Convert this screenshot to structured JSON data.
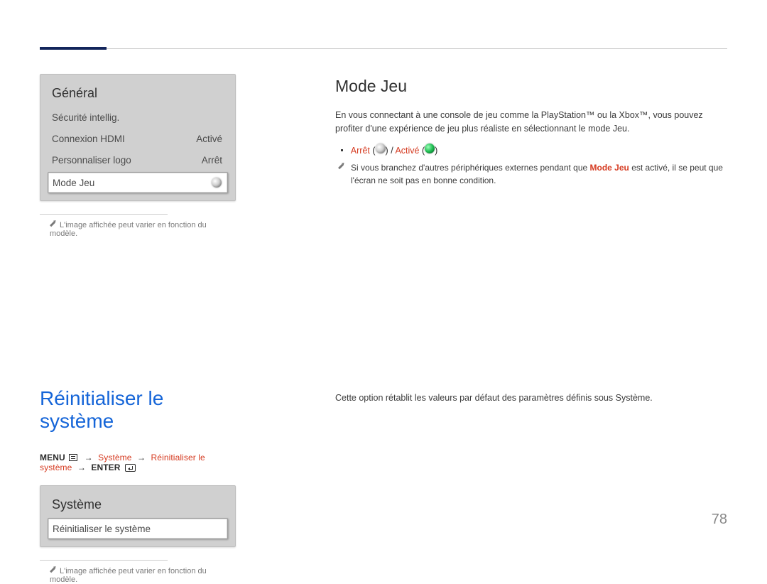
{
  "pageNumber": "78",
  "panel1": {
    "title": "Général",
    "rows": [
      {
        "label": "Sécurité intellig.",
        "value": ""
      },
      {
        "label": "Connexion HDMI",
        "value": "Activé"
      },
      {
        "label": "Personnaliser logo",
        "value": "Arrêt"
      }
    ],
    "selected": {
      "label": "Mode Jeu"
    }
  },
  "note_img_varies": "L'image affichée peut varier en fonction du modèle.",
  "modeJeu": {
    "heading": "Mode Jeu",
    "desc": "En vous connectant à une console de jeu comme la PlayStation™ ou la Xbox™, vous pouvez profiter d'une expérience de jeu plus réaliste en sélectionnant le mode Jeu.",
    "opt_off": "Arrêt",
    "opt_on": "Activé",
    "warn_prefix": "Si vous branchez d'autres périphériques externes pendant que ",
    "warn_term": "Mode Jeu",
    "warn_suffix": " est activé, il se peut que l'écran ne soit pas en bonne condition."
  },
  "reset": {
    "title": "Réinitialiser le système",
    "path_menu": "MENU",
    "path_systeme": "Système",
    "path_reinit": "Réinitialiser le système",
    "path_enter": "ENTER",
    "desc": "Cette option rétablit les valeurs par défaut des paramètres définis sous Système."
  },
  "panel2": {
    "title": "Système",
    "selected": {
      "label": "Réinitialiser le système"
    }
  }
}
